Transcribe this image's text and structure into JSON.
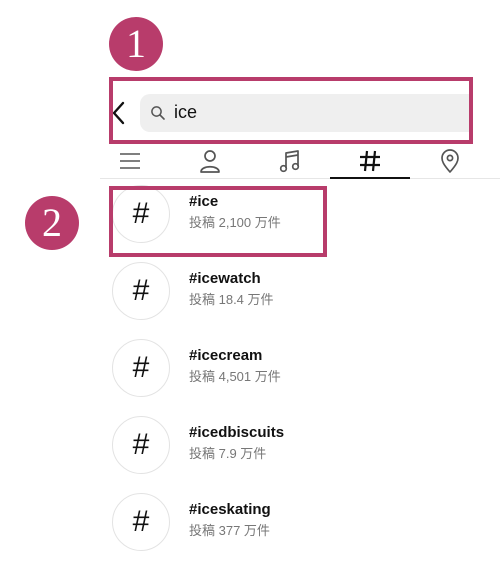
{
  "annotations": {
    "step1": "1",
    "step2": "2",
    "highlight_color": "#b83c6b"
  },
  "search": {
    "query": "ice"
  },
  "tabs": [
    {
      "name": "top",
      "icon": "list-icon"
    },
    {
      "name": "accounts",
      "icon": "person-icon"
    },
    {
      "name": "audio",
      "icon": "music-note-icon"
    },
    {
      "name": "tags",
      "icon": "hashtag-icon",
      "active": true
    },
    {
      "name": "places",
      "icon": "location-pin-icon"
    }
  ],
  "results": [
    {
      "symbol": "#",
      "name": "#ice",
      "count": "投稿 2,100 万件"
    },
    {
      "symbol": "#",
      "name": "#icewatch",
      "count": "投稿 18.4 万件"
    },
    {
      "symbol": "#",
      "name": "#icecream",
      "count": "投稿 4,501 万件"
    },
    {
      "symbol": "#",
      "name": "#icedbiscuits",
      "count": "投稿 7.9 万件"
    },
    {
      "symbol": "#",
      "name": "#iceskating",
      "count": "投稿 377 万件"
    }
  ]
}
